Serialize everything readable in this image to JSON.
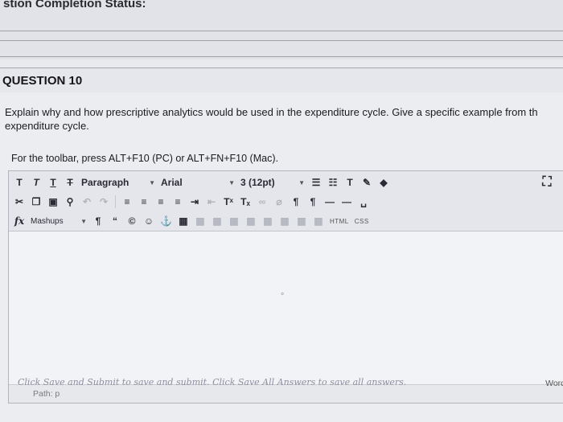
{
  "completion": {
    "title": "stion Completion Status:"
  },
  "question": {
    "title": "QUESTION 10",
    "prompt_line1": "Explain why and how prescriptive analytics would be used in the expenditure cycle. Give a specific example from th",
    "prompt_line2": "expenditure cycle.",
    "toolbar_hint": "For the toolbar, press ALT+F10 (PC) or ALT+FN+F10 (Mac)."
  },
  "toolbar": {
    "paragraph_select": "Paragraph",
    "font_select": "Arial",
    "size_select": "3 (12pt)",
    "mashups": "Mashups",
    "html_label": "HTML",
    "css_label": "CSS"
  },
  "editor": {
    "path_label": "Path: p",
    "word_label": "Word"
  },
  "footer": {
    "hint": "Click Save and Submit to save and submit. Click Save All Answers to save all answers."
  },
  "icons": [
    "bold-t-icon",
    "italic-t-icon",
    "underline-t-icon",
    "strikethrough-t-icon",
    "cut-icon",
    "copy-icon",
    "paste-icon",
    "find-icon",
    "undo-icon",
    "redo-icon",
    "align-left-icon",
    "align-center-icon",
    "align-right-icon",
    "justify-icon",
    "bullet-list-icon",
    "numbered-list-icon",
    "superscript-icon",
    "subscript-icon",
    "link-icon",
    "unlink-icon",
    "ltr-icon",
    "rtl-icon",
    "hr-icon",
    "formula-icon",
    "pilcrow-icon",
    "quote-icon",
    "copyright-icon",
    "emoji-icon",
    "anchor-icon",
    "table-icon",
    "text-color-icon",
    "highlight-icon",
    "eraser-icon",
    "fullscreen-icon"
  ]
}
